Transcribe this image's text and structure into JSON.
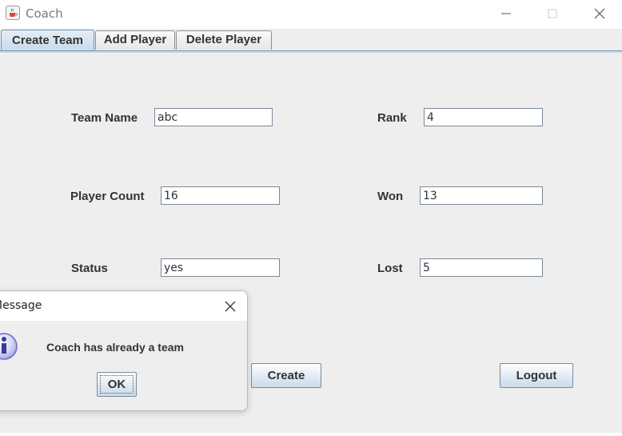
{
  "window": {
    "title": "Coach",
    "icon": "java-cup-icon"
  },
  "tabs": [
    {
      "label": "Create Team",
      "active": true
    },
    {
      "label": "Add Player",
      "active": false
    },
    {
      "label": "Delete Player",
      "active": false
    }
  ],
  "form": {
    "team_name": {
      "label": "Team Name",
      "value": "abc"
    },
    "player_count": {
      "label": "Player Count",
      "value": "16"
    },
    "status": {
      "label": "Status",
      "value": "yes"
    },
    "rank": {
      "label": "Rank",
      "value": "4"
    },
    "won": {
      "label": "Won",
      "value": "13"
    },
    "lost": {
      "label": "Lost",
      "value": "5"
    }
  },
  "buttons": {
    "create": "Create",
    "logout": "Logout"
  },
  "dialog": {
    "title": "Message",
    "message": "Coach has already a team",
    "ok_label": "OK",
    "icon": "info-icon"
  },
  "colors": {
    "panel_bg": "#eeeeee",
    "active_tab": "#c6d9ec",
    "info_icon": "#6a6cc8"
  }
}
